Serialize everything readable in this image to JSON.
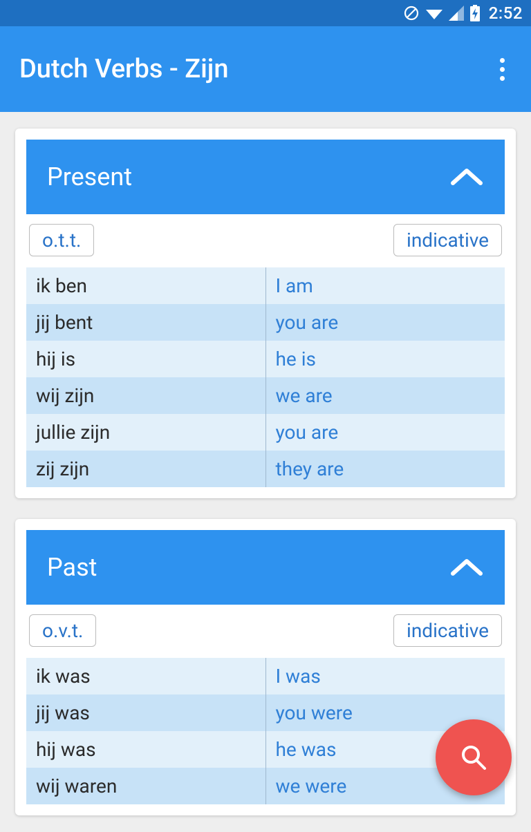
{
  "status": {
    "time": "2:52"
  },
  "app": {
    "title": "Dutch Verbs - Zijn"
  },
  "cards": [
    {
      "title": "Present",
      "left_tag": "o.t.t.",
      "right_tag": "indicative",
      "rows": [
        {
          "dutch": "ik ben",
          "english": "I am"
        },
        {
          "dutch": "jij bent",
          "english": "you are"
        },
        {
          "dutch": "hij is",
          "english": "he is"
        },
        {
          "dutch": "wij zijn",
          "english": "we are"
        },
        {
          "dutch": "jullie zijn",
          "english": "you are"
        },
        {
          "dutch": "zij zijn",
          "english": "they are"
        }
      ]
    },
    {
      "title": "Past",
      "left_tag": "o.v.t.",
      "right_tag": "indicative",
      "rows": [
        {
          "dutch": "ik was",
          "english": "I was"
        },
        {
          "dutch": "jij was",
          "english": "you were"
        },
        {
          "dutch": "hij was",
          "english": "he was"
        },
        {
          "dutch": "wij waren",
          "english": "we were"
        }
      ]
    }
  ]
}
